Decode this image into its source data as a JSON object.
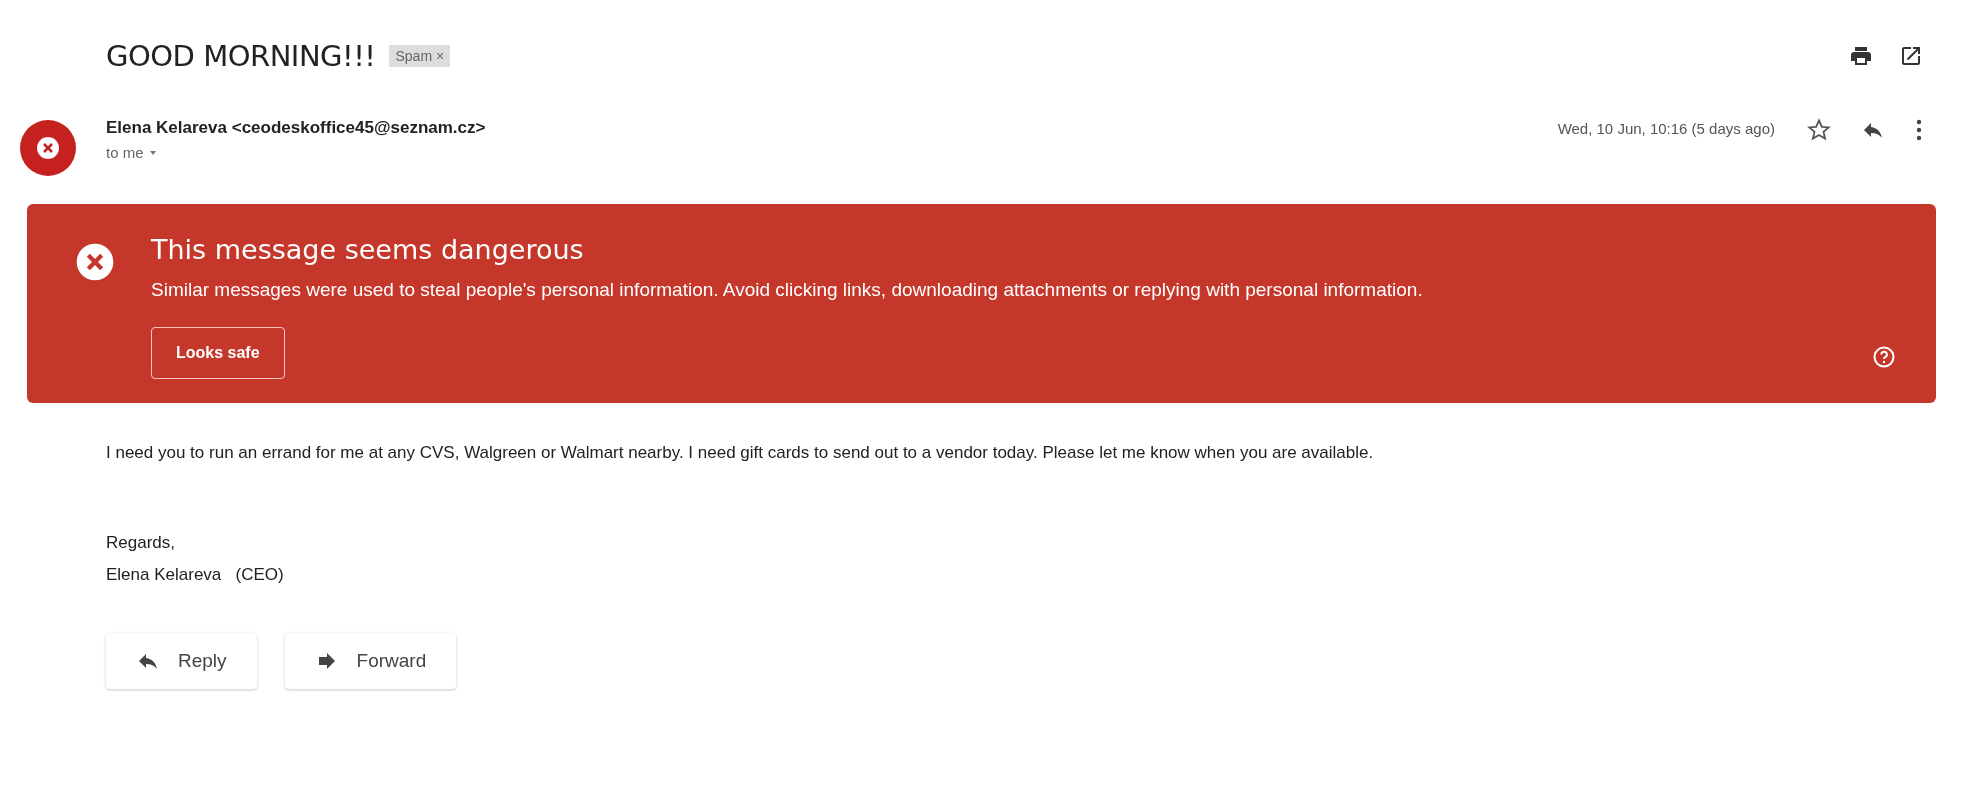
{
  "subject": "GOOD MORNING!!!",
  "label": {
    "text": "Spam",
    "remove": "×"
  },
  "sender": {
    "name": "Elena Kelareva",
    "email": "<ceodeskoffice45@seznam.cz>",
    "recipient": "to me",
    "date": "Wed, 10 Jun, 10:16 (5 days ago)",
    "starred": false
  },
  "warning": {
    "title": "This message seems dangerous",
    "text": "Similar messages were used to steal people's personal information. Avoid clicking links, downloading attachments or replying with personal information.",
    "button": "Looks safe"
  },
  "body": [
    "I need you to run an errand for me at any CVS, Walgreen or Walmart nearby. I need gift cards to send out to a vendor today. Please let me know when you are available."
  ],
  "signature": [
    "Regards,",
    "Elena Kelareva   (CEO)"
  ],
  "actions": [
    {
      "kind": "reply",
      "label": "Reply"
    },
    {
      "kind": "forward",
      "label": "Forward"
    }
  ]
}
